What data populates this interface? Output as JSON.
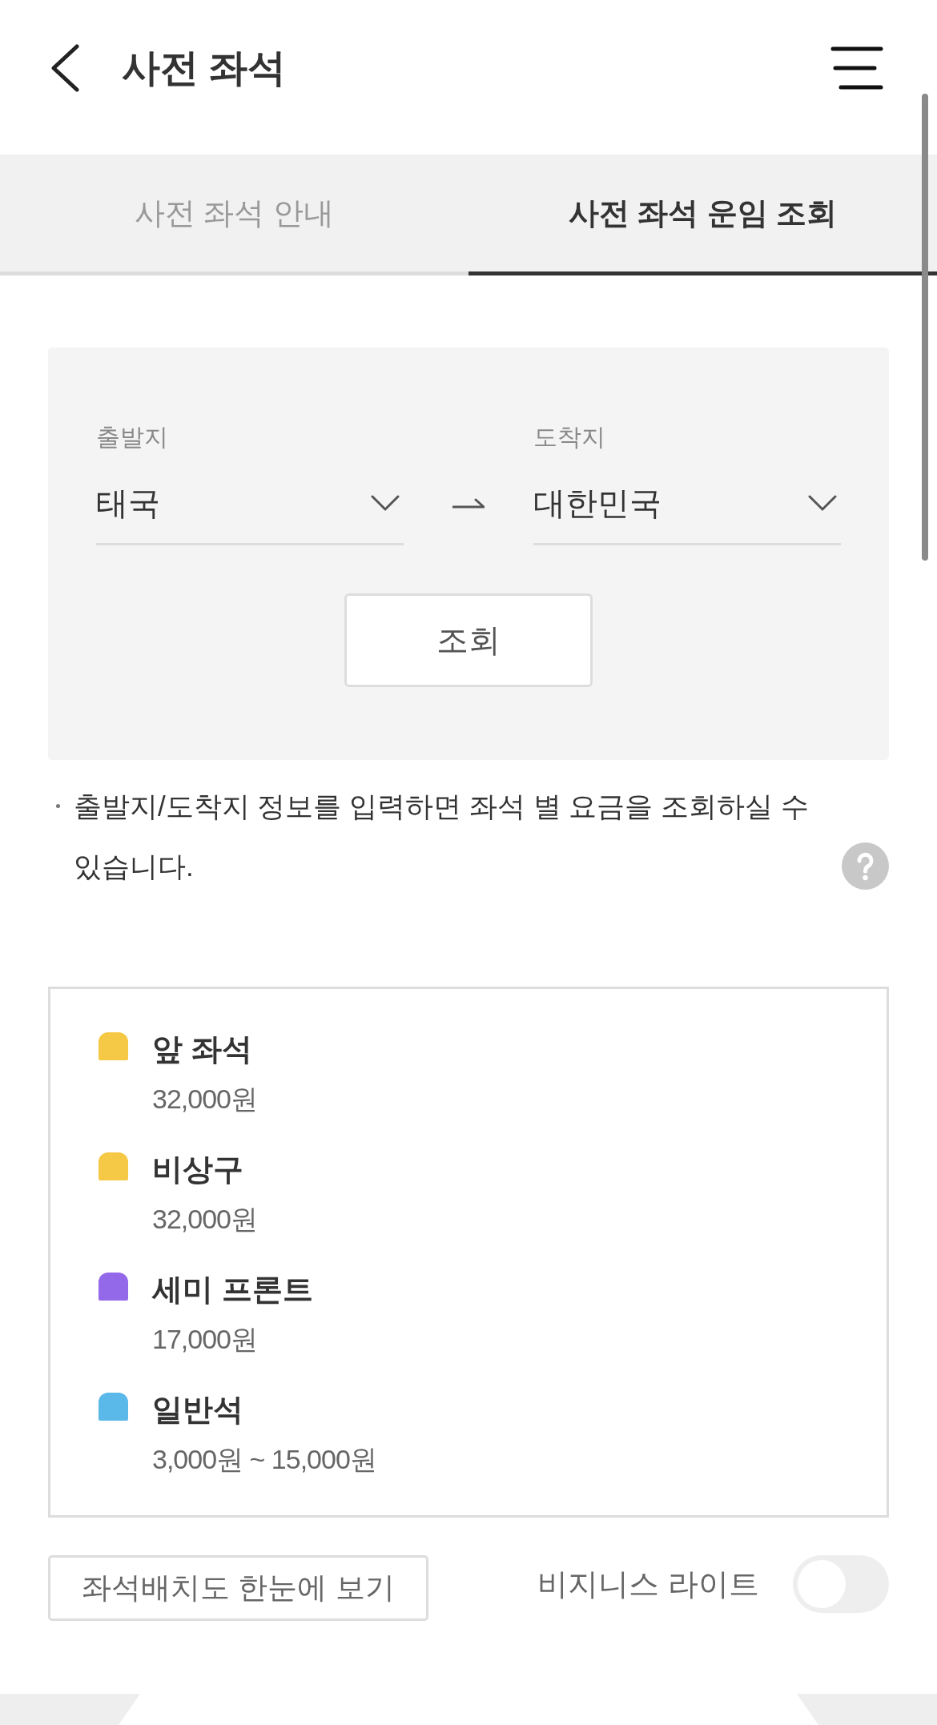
{
  "header": {
    "title": "사전 좌석"
  },
  "tabs": [
    {
      "label": "사전 좌석 안내",
      "selected": false
    },
    {
      "label": "사전 좌석 운임 조회",
      "selected": true
    }
  ],
  "search": {
    "fields": [
      {
        "label": "출발지",
        "value": "태국"
      },
      {
        "label": "도착지",
        "value": "대한민국"
      }
    ],
    "button": "조회"
  },
  "notice": "출발지/도착지 정보를 입력하면 좌석 별 요금을 조회하실 수 있습니다.",
  "legend": {
    "items": [
      {
        "name": "앞 좌석",
        "price": "32,000원",
        "color": "#f5c945"
      },
      {
        "name": "비상구",
        "price": "32,000원",
        "color": "#f5c945"
      },
      {
        "name": "세미 프론트",
        "price": "17,000원",
        "color": "#9469e9"
      },
      {
        "name": "일반석",
        "price": "3,000원 ~ 15,000원",
        "color": "#5bb9ea"
      }
    ]
  },
  "seat_map_button": "좌석배치도 한눈에 보기",
  "business_lite": {
    "label": "비지니스 라이트",
    "on": false
  }
}
